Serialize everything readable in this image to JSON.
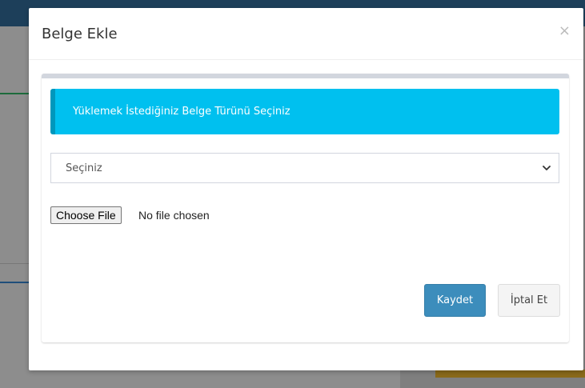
{
  "modal": {
    "title": "Belge Ekle",
    "close_symbol": "×"
  },
  "callout": {
    "text": "Yüklemek İstediğiniz Belge Türünü Seçiniz",
    "color": "#00c0ef"
  },
  "document_type_select": {
    "selected_value": "Seçiniz",
    "icon": "chevron-down-icon"
  },
  "file_input": {
    "button_label": "Choose File",
    "status_text": "No file chosen"
  },
  "buttons": {
    "save_label": "Kaydet",
    "cancel_label": "İptal Et",
    "save_color": "#3c8dbc"
  }
}
